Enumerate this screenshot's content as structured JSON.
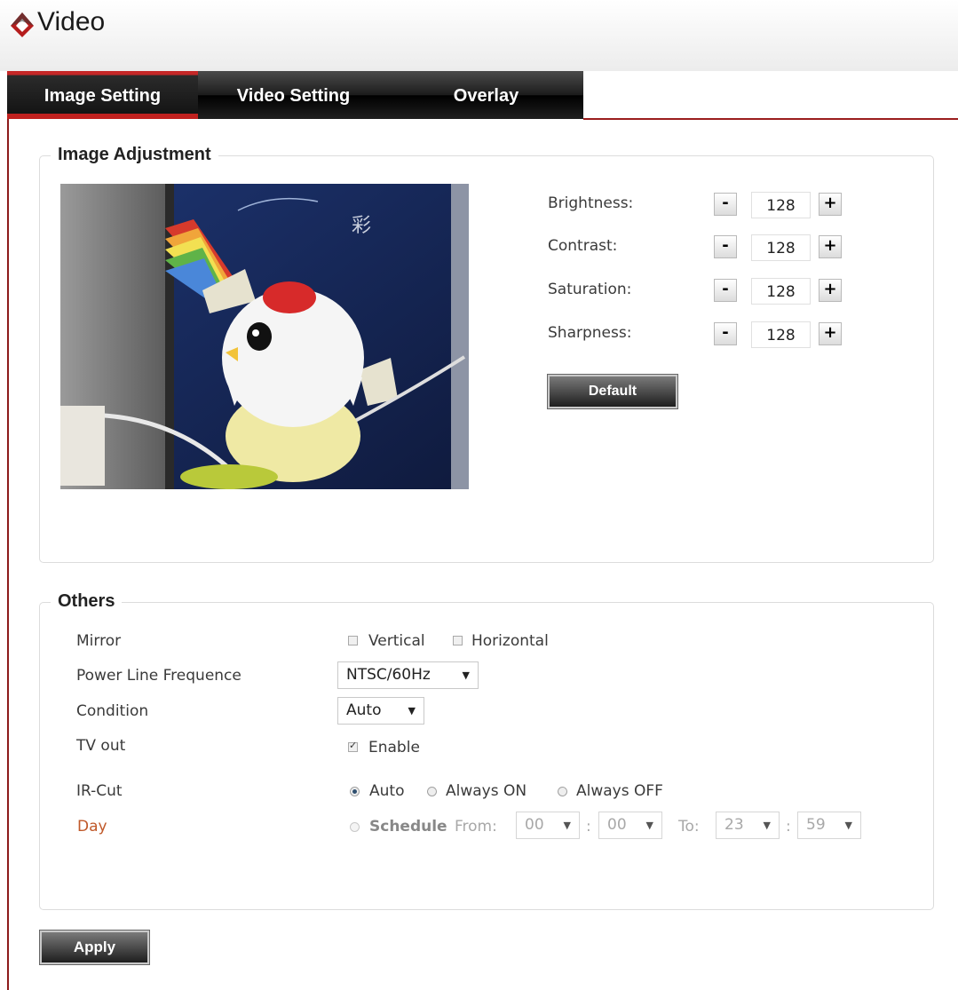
{
  "app": {
    "title": "Video",
    "logo_icon": "red-diamond-logo-icon"
  },
  "tabs": [
    {
      "label": "Image Setting",
      "active": true
    },
    {
      "label": "Video Setting",
      "active": false
    },
    {
      "label": "Overlay",
      "active": false
    }
  ],
  "colors": {
    "accent_red": "#c0211f",
    "tab_dark": "#1c1c1c",
    "day_label": "#c0592a"
  },
  "image_adjustment": {
    "legend": "Image Adjustment",
    "preview_image": "camera-preview-rubber-chicken-toy",
    "controls": [
      {
        "label": "Brightness:",
        "value": "128",
        "minus": "-",
        "plus": "+"
      },
      {
        "label": "Contrast:",
        "value": "128",
        "minus": "-",
        "plus": "+"
      },
      {
        "label": "Saturation:",
        "value": "128",
        "minus": "-",
        "plus": "+"
      },
      {
        "label": "Sharpness:",
        "value": "128",
        "minus": "-",
        "plus": "+"
      }
    ],
    "default_button": "Default"
  },
  "others": {
    "legend": "Others",
    "mirror": {
      "label": "Mirror",
      "vertical": "Vertical",
      "vertical_checked": false,
      "horizontal": "Horizontal",
      "horizontal_checked": false
    },
    "power_line": {
      "label": "Power Line Frequence",
      "selected": "NTSC/60Hz"
    },
    "condition": {
      "label": "Condition",
      "selected": "Auto"
    },
    "tv_out": {
      "label": "TV out",
      "option": "Enable",
      "checked": true
    },
    "ir_cut": {
      "label": "IR-Cut",
      "options": [
        "Auto",
        "Always ON",
        "Always OFF"
      ],
      "selected": "Auto"
    },
    "day": {
      "label": "Day",
      "schedule": "Schedule",
      "from_label": "From:",
      "from_hour": "00",
      "from_minute": "00",
      "to_label": "To:",
      "to_hour": "23",
      "to_minute": "59",
      "separator": ":"
    }
  },
  "apply_button": "Apply"
}
